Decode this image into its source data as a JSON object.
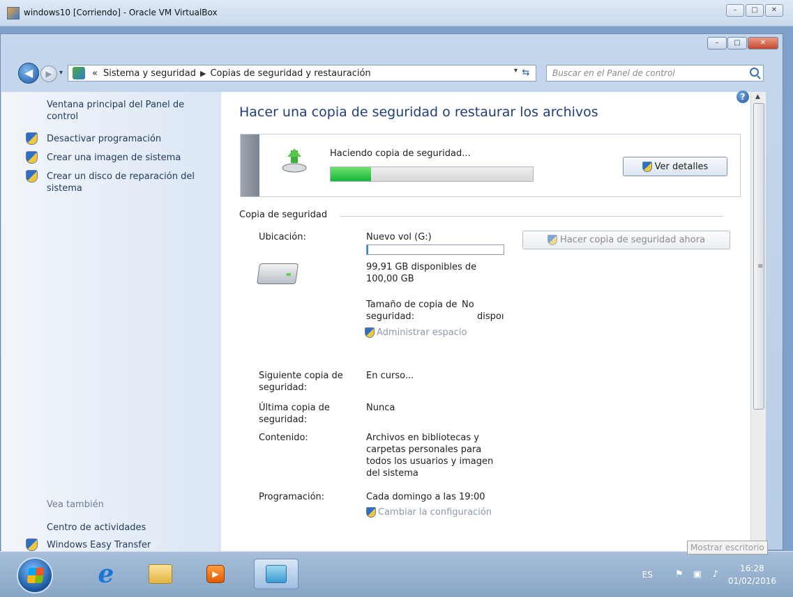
{
  "host_window": {
    "title": "windows10 [Corriendo] - Oracle VM VirtualBox",
    "min": "–",
    "max": "□",
    "close": "✕"
  },
  "explorer": {
    "controls": {
      "min": "–",
      "max": "□",
      "close": "✕"
    },
    "nav": {
      "back": "◀",
      "forward": "▶",
      "dropdown": "▾"
    },
    "breadcrumb": {
      "prefix": "«",
      "items": [
        "Sistema y seguridad",
        "Copias de seguridad y restauración"
      ],
      "separator": "▶",
      "dropdown": "▾",
      "refresh": "⇆"
    },
    "search": {
      "placeholder": "Buscar en el Panel de control"
    }
  },
  "sidebar": {
    "home_link": "Ventana principal del Panel de control",
    "items": [
      {
        "label": "Desactivar programación"
      },
      {
        "label": "Crear una imagen de sistema"
      },
      {
        "label": "Crear un disco de reparación del sistema"
      }
    ],
    "see_also_header": "Vea también",
    "see_also": [
      {
        "label": "Centro de actividades"
      },
      {
        "label": "Windows Easy Transfer"
      }
    ]
  },
  "main": {
    "help": "?",
    "title": "Hacer una copia de seguridad o restaurar los archivos",
    "progress": {
      "label": "Haciendo copia de seguridad...",
      "fraction": 0.2,
      "button": "Ver detalles"
    },
    "section_label": "Copia de seguridad",
    "backup_now_button": "Hacer copia de seguridad ahora",
    "location": {
      "label": "Ubicación:",
      "value": "Nuevo vol (G:)",
      "used_fraction": 0.01,
      "free": "99,91 GB disponibles de 100,00 GB"
    },
    "backup_size": {
      "label_line1": "Tamaño de copia de",
      "label_line2": "seguridad:",
      "value_line1": "No",
      "value_line2": "dispoı"
    },
    "manage_space": "Administrar espacio",
    "next_backup": {
      "label_line1": "Siguiente copia de",
      "label_line2": "seguridad:",
      "value": "En curso..."
    },
    "last_backup": {
      "label_line1": "Última copia de",
      "label_line2": "seguridad:",
      "value": "Nunca"
    },
    "contents": {
      "label": "Contenido:",
      "value_lines": [
        "Archivos en bibliotecas y",
        "carpetas personales para",
        "todos los usuarios y imagen",
        "del sistema"
      ]
    },
    "schedule": {
      "label": "Programación:",
      "value": "Cada domingo a las 19:00"
    },
    "change_settings": "Cambiar la configuración"
  },
  "scrollbar": {
    "up": "▲",
    "grip": "≡"
  },
  "tooltip": "Mostrar escritorio",
  "taskbar": {
    "ie_glyph": "e",
    "media_glyph": "▶",
    "language": "ES",
    "tray_icons": [
      "⚑",
      "▣",
      "♪"
    ],
    "time": "16:28",
    "date": "01/02/2016"
  }
}
